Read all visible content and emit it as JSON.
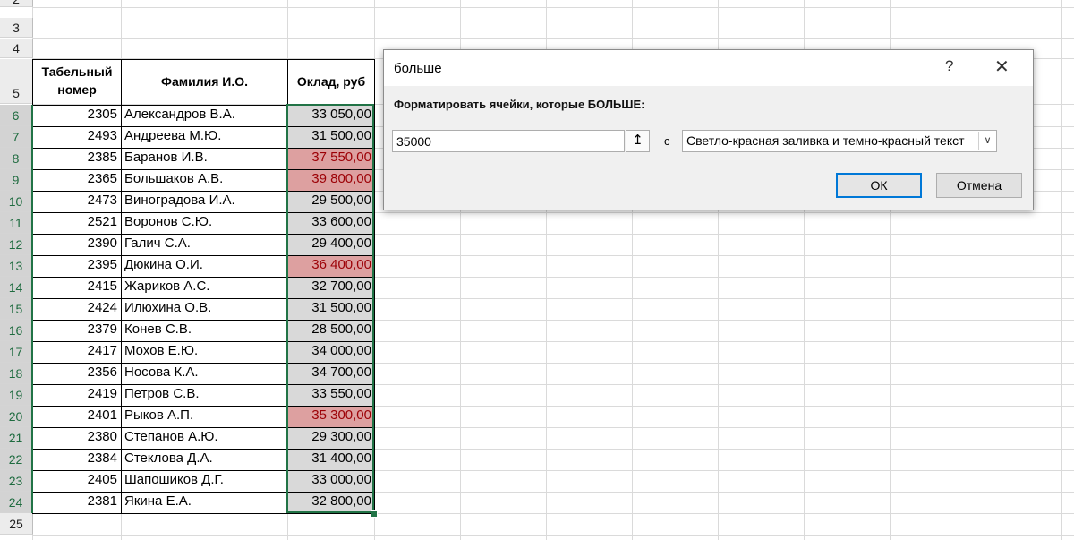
{
  "sheet": {
    "top_partial_row": "2",
    "rows_top": [
      "3",
      "4",
      "5"
    ],
    "bottom_row": "25",
    "headers": {
      "tab_number": "Табельный номер",
      "name": "Фамилия И.О.",
      "salary": "Оклад, руб"
    },
    "data_rows": [
      {
        "row": "6",
        "num": "2305",
        "name": "Александров В.А.",
        "salary": "33 050,00",
        "highlight": false
      },
      {
        "row": "7",
        "num": "2493",
        "name": "Андреева М.Ю.",
        "salary": "31 500,00",
        "highlight": false
      },
      {
        "row": "8",
        "num": "2385",
        "name": "Баранов И.В.",
        "salary": "37 550,00",
        "highlight": true
      },
      {
        "row": "9",
        "num": "2365",
        "name": "Большаков А.В.",
        "salary": "39 800,00",
        "highlight": true
      },
      {
        "row": "10",
        "num": "2473",
        "name": "Виноградова И.А.",
        "salary": "29 500,00",
        "highlight": false
      },
      {
        "row": "11",
        "num": "2521",
        "name": "Воронов С.Ю.",
        "salary": "33 600,00",
        "highlight": false
      },
      {
        "row": "12",
        "num": "2390",
        "name": "Галич С.А.",
        "salary": "29 400,00",
        "highlight": false
      },
      {
        "row": "13",
        "num": "2395",
        "name": "Дюкина О.И.",
        "salary": "36 400,00",
        "highlight": true
      },
      {
        "row": "14",
        "num": "2415",
        "name": "Жариков А.С.",
        "salary": "32 700,00",
        "highlight": false
      },
      {
        "row": "15",
        "num": "2424",
        "name": "Илюхина О.В.",
        "salary": "31 500,00",
        "highlight": false
      },
      {
        "row": "16",
        "num": "2379",
        "name": "Конев С.В.",
        "salary": "28 500,00",
        "highlight": false
      },
      {
        "row": "17",
        "num": "2417",
        "name": "Мохов Е.Ю.",
        "salary": "34 000,00",
        "highlight": false
      },
      {
        "row": "18",
        "num": "2356",
        "name": "Носова К.А.",
        "salary": "34 700,00",
        "highlight": false
      },
      {
        "row": "19",
        "num": "2419",
        "name": "Петров С.В.",
        "salary": "33 550,00",
        "highlight": false
      },
      {
        "row": "20",
        "num": "2401",
        "name": "Рыков А.П.",
        "salary": "35 300,00",
        "highlight": true
      },
      {
        "row": "21",
        "num": "2380",
        "name": "Степанов А.Ю.",
        "salary": "29 300,00",
        "highlight": false
      },
      {
        "row": "22",
        "num": "2384",
        "name": "Стеклова Д.А.",
        "salary": "31 400,00",
        "highlight": false
      },
      {
        "row": "23",
        "num": "2405",
        "name": "Шапошиков Д.Г.",
        "salary": "33 000,00",
        "highlight": false
      },
      {
        "row": "24",
        "num": "2381",
        "name": "Якина Е.А.",
        "salary": "32 800,00",
        "highlight": false
      }
    ],
    "colors": {
      "selected_fill": "#d9d9d9",
      "highlight_fill": "#dda0a0",
      "highlight_text": "#9c0006",
      "selection_border": "#217346"
    }
  },
  "dialog": {
    "title": "больше",
    "help": "?",
    "close": "✕",
    "label": "Форматировать ячейки, которые БОЛЬШЕ:",
    "value": "35000",
    "collapse_icon": "↥",
    "with_label": "с",
    "format_option": "Светло-красная заливка и темно-красный текст",
    "ok": "ОК",
    "cancel": "Отмена"
  }
}
